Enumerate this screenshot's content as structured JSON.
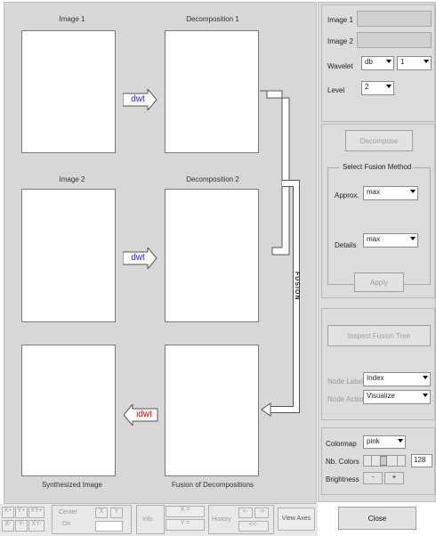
{
  "figure": {
    "title_image1": "Image 1",
    "title_dec1": "Decomposition 1",
    "title_image2": "Image 2",
    "title_dec2": "Decomposition 2",
    "title_synth": "Synthesized Image",
    "title_fusion": "Fusion of Decompositions",
    "dwt1": "dwt",
    "dwt2": "dwt",
    "idwt": "idwt",
    "fusion_label": "FUSION"
  },
  "panel": {
    "image1_label": "Image 1",
    "image2_label": "Image 2",
    "wavelet_label": "Wavelet",
    "wavelet_family": "db",
    "wavelet_order": "1",
    "level_label": "Level",
    "level_value": "2",
    "decompose_btn": "Decompose",
    "fusion_method_title": "Select Fusion Method",
    "approx_label": "Approx.",
    "approx_value": "max",
    "details_label": "Details",
    "details_value": "max",
    "apply_btn": "Apply",
    "inspect_btn": "Inspect Fusion Tree",
    "node_label_label": "Node Label",
    "node_label_value": "Index",
    "node_action_label": "Node Action",
    "node_action_value": "Visualize",
    "colormap_label": "Colormap",
    "colormap_value": "pink",
    "nb_colors_label": "Nb. Colors",
    "nb_colors_value": "128",
    "brightness_label": "Brightness",
    "minus": "-",
    "plus": "+",
    "close_btn": "Close"
  },
  "toolbar": {
    "xplus": "X+",
    "yplus": "Y+",
    "xyplus": "XY+",
    "xminus": "X-",
    "yminus": "Y-",
    "xyminus": "XY-",
    "center": "Center",
    "on": "On",
    "x": "X",
    "y": "Y",
    "info": "Info",
    "x_eq": "X =",
    "y_eq": "Y =",
    "history": "History",
    "back": "<-",
    "fwd": "->",
    "back2": "<<-",
    "view_axes": "View Axes"
  },
  "colors": {
    "dwt": "#1a1aff",
    "idwt": "#e00000",
    "panel": "#dcdcdc"
  }
}
